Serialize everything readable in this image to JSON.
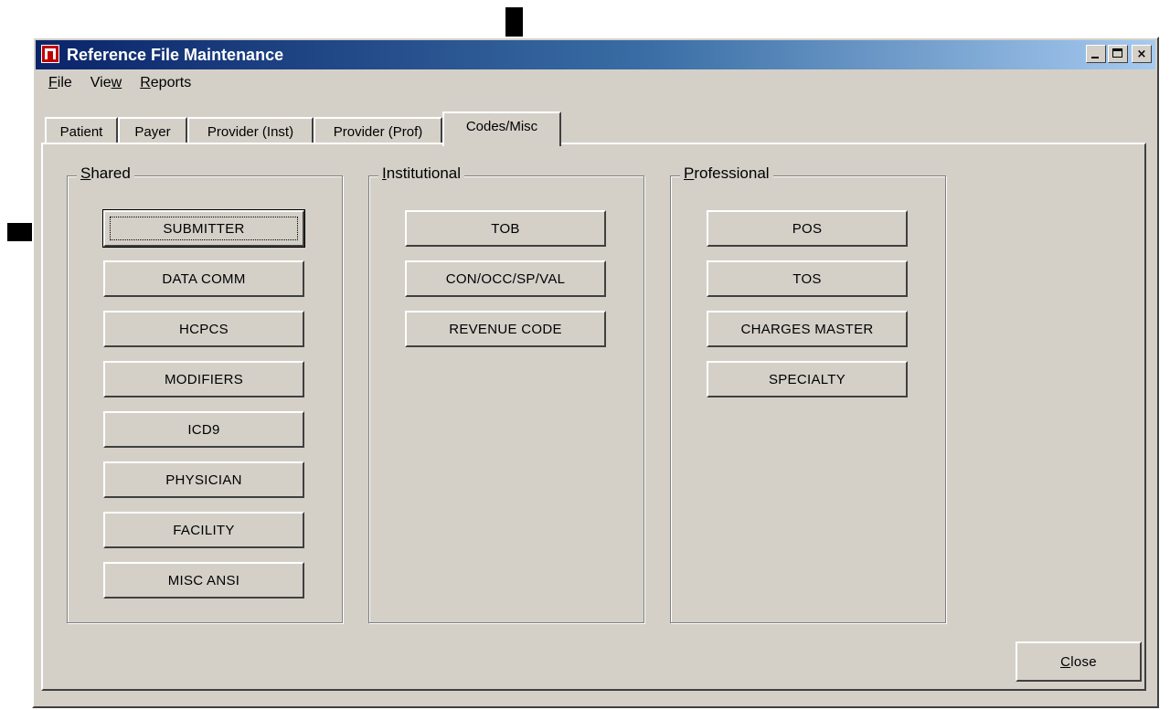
{
  "window": {
    "title": "Reference File Maintenance",
    "min_glyph": "minimize",
    "max_glyph": "maximize",
    "close_glyph": "×"
  },
  "menu": [
    {
      "label": "File",
      "underline": "F",
      "rest": "ile"
    },
    {
      "label": "View",
      "pre": "Vie",
      "underline": "w",
      "rest": ""
    },
    {
      "label": "Reports",
      "underline": "R",
      "rest": "eports"
    }
  ],
  "tabs": [
    "Patient",
    "Payer",
    "Provider (Inst)",
    "Provider (Prof)",
    "Codes/Misc"
  ],
  "active_tab": "Codes/Misc",
  "groups": {
    "shared": {
      "label_u": "S",
      "label_rest": "hared",
      "buttons": [
        "SUBMITTER",
        "DATA COMM",
        "HCPCS",
        "MODIFIERS",
        "ICD9",
        "PHYSICIAN",
        "FACILITY",
        "MISC ANSI"
      ]
    },
    "institutional": {
      "label_u": "I",
      "label_rest": "nstitutional",
      "buttons": [
        "TOB",
        "CON/OCC/SP/VAL",
        "REVENUE CODE"
      ]
    },
    "professional": {
      "label_u": "P",
      "label_rest": "rofessional",
      "buttons": [
        "POS",
        "TOS",
        "CHARGES MASTER",
        "SPECIALTY"
      ]
    }
  },
  "close_button": {
    "underline": "C",
    "rest": "lose"
  },
  "colors": {
    "face": "#d4d0c8",
    "title_start": "#0a246a",
    "title_end": "#a6caf0",
    "icon": "#c00000"
  }
}
